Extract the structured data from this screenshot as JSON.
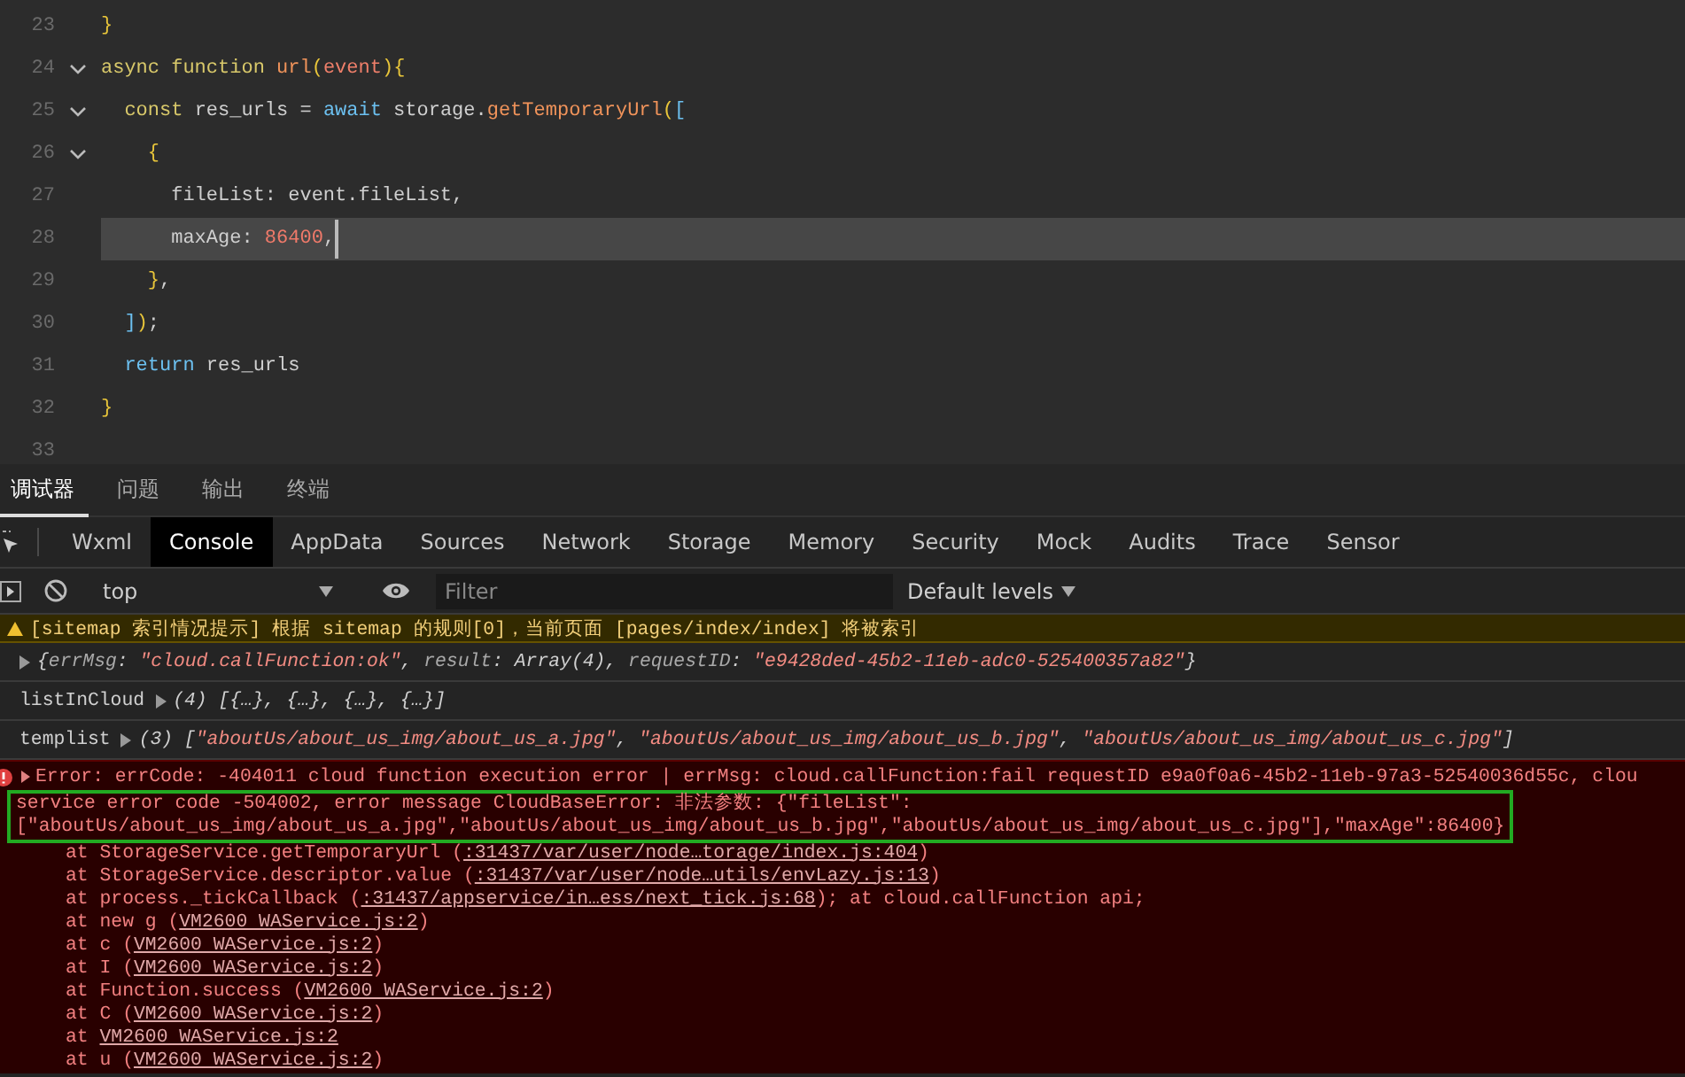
{
  "editor": {
    "lines": [
      {
        "number": "23",
        "fold": false,
        "current": false,
        "tokens": [
          {
            "text": "}",
            "kind": "brace"
          }
        ]
      },
      {
        "number": "24",
        "fold": true,
        "current": false,
        "tokens": [
          {
            "text": "async function ",
            "kind": "kw"
          },
          {
            "text": "url",
            "kind": "fn"
          },
          {
            "text": "(",
            "kind": "brace"
          },
          {
            "text": "event",
            "kind": "param"
          },
          {
            "text": "){",
            "kind": "brace"
          }
        ]
      },
      {
        "number": "25",
        "fold": true,
        "current": false,
        "tokens": [
          {
            "text": "  const ",
            "kind": "kw"
          },
          {
            "text": "res_urls = ",
            "kind": "plain"
          },
          {
            "text": "await ",
            "kind": "blue"
          },
          {
            "text": "storage.",
            "kind": "plain"
          },
          {
            "text": "getTemporaryUrl",
            "kind": "fn"
          },
          {
            "text": "(",
            "kind": "brace"
          },
          {
            "text": "[",
            "kind": "blue"
          }
        ]
      },
      {
        "number": "26",
        "fold": true,
        "current": false,
        "tokens": [
          {
            "text": "    {",
            "kind": "brace"
          }
        ]
      },
      {
        "number": "27",
        "fold": false,
        "current": false,
        "tokens": [
          {
            "text": "      fileList: event.fileList,",
            "kind": "plain"
          }
        ]
      },
      {
        "number": "28",
        "fold": false,
        "current": true,
        "tokens": [
          {
            "text": "      maxAge: ",
            "kind": "plain"
          },
          {
            "text": "86400",
            "kind": "num"
          },
          {
            "text": ",",
            "kind": "plain"
          }
        ]
      },
      {
        "number": "29",
        "fold": false,
        "current": false,
        "tokens": [
          {
            "text": "    }",
            "kind": "brace"
          },
          {
            "text": ",",
            "kind": "plain"
          }
        ]
      },
      {
        "number": "30",
        "fold": false,
        "current": false,
        "tokens": [
          {
            "text": "  ]",
            "kind": "blue"
          },
          {
            "text": ")",
            "kind": "brace"
          },
          {
            "text": ";",
            "kind": "plain"
          }
        ]
      },
      {
        "number": "31",
        "fold": false,
        "current": false,
        "tokens": [
          {
            "text": "  return ",
            "kind": "blue"
          },
          {
            "text": "res_urls",
            "kind": "plain"
          }
        ]
      },
      {
        "number": "32",
        "fold": false,
        "current": false,
        "tokens": [
          {
            "text": "}",
            "kind": "brace"
          }
        ]
      },
      {
        "number": "33",
        "fold": false,
        "current": false
      }
    ]
  },
  "panel_tabs": [
    {
      "label": "调试器",
      "selected": true
    },
    {
      "label": "问题",
      "selected": false
    },
    {
      "label": "输出",
      "selected": false
    },
    {
      "label": "终端",
      "selected": false
    }
  ],
  "devtools_tabs": [
    {
      "label": "Wxml",
      "selected": false
    },
    {
      "label": "Console",
      "selected": true
    },
    {
      "label": "AppData",
      "selected": false
    },
    {
      "label": "Sources",
      "selected": false
    },
    {
      "label": "Network",
      "selected": false
    },
    {
      "label": "Storage",
      "selected": false
    },
    {
      "label": "Memory",
      "selected": false
    },
    {
      "label": "Security",
      "selected": false
    },
    {
      "label": "Mock",
      "selected": false
    },
    {
      "label": "Audits",
      "selected": false
    },
    {
      "label": "Trace",
      "selected": false
    },
    {
      "label": "Sensor",
      "selected": false
    }
  ],
  "toolbar": {
    "context": "top",
    "filter_placeholder": "Filter",
    "levels": "Default levels"
  },
  "console": {
    "messages": [
      {
        "kind": "warning",
        "text": "[sitemap 索引情况提示] 根据 sitemap 的规则[0]，当前页面 [pages/index/index] 将被索引"
      },
      {
        "kind": "object",
        "tokens": [
          {
            "text": "{",
            "kind": "punc"
          },
          {
            "text": "errMsg",
            "kind": "key"
          },
          {
            "text": ": ",
            "kind": "punc"
          },
          {
            "text": "\"cloud.callFunction:ok\"",
            "kind": "str"
          },
          {
            "text": ", ",
            "kind": "punc"
          },
          {
            "text": "result",
            "kind": "key"
          },
          {
            "text": ": ",
            "kind": "punc"
          },
          {
            "text": "Array(4)",
            "kind": "val"
          },
          {
            "text": ", ",
            "kind": "punc"
          },
          {
            "text": "requestID",
            "kind": "key"
          },
          {
            "text": ": ",
            "kind": "punc"
          },
          {
            "text": "\"e9428ded-45b2-11eb-adc0-525400357a82\"",
            "kind": "str"
          },
          {
            "text": "}",
            "kind": "punc"
          }
        ]
      },
      {
        "kind": "labelled",
        "label": "listInCloud",
        "tokens": [
          {
            "text": "(4) [{…}, {…}, {…}, {…}]",
            "kind": "val"
          }
        ]
      },
      {
        "kind": "labelled",
        "label": "templist",
        "tokens": [
          {
            "text": "(3) [",
            "kind": "val"
          },
          {
            "text": "\"aboutUs/about_us_img/about_us_a.jpg\"",
            "kind": "str"
          },
          {
            "text": ", ",
            "kind": "punc"
          },
          {
            "text": "\"aboutUs/about_us_img/about_us_b.jpg\"",
            "kind": "str"
          },
          {
            "text": ", ",
            "kind": "punc"
          },
          {
            "text": "\"aboutUs/about_us_img/about_us_c.jpg\"",
            "kind": "str"
          },
          {
            "text": "]",
            "kind": "val"
          }
        ]
      }
    ],
    "error": {
      "head": "Error: errCode: -404011 cloud function execution error | errMsg: cloud.callFunction:fail requestID e9a0f0a6-45b2-11eb-97a3-52540036d55c, clou",
      "detail": [
        "service error code -504002, error message CloudBaseError: 非法参数: {\"fileList\":",
        "[\"aboutUs/about_us_img/about_us_a.jpg\",\"aboutUs/about_us_img/about_us_b.jpg\",\"aboutUs/about_us_img/about_us_c.jpg\"],\"maxAge\":86400}"
      ],
      "stack": [
        {
          "prefix": "at StorageService.getTemporaryUrl (",
          "link": ":31437/var/user/node…torage/index.js:404",
          "suffix": ")"
        },
        {
          "prefix": "at StorageService.descriptor.value (",
          "link": ":31437/var/user/node…utils/envLazy.js:13",
          "suffix": ")"
        },
        {
          "prefix": "at process._tickCallback (",
          "link": ":31437/appservice/in…ess/next_tick.js:68",
          "suffix": "); at cloud.callFunction api;"
        },
        {
          "prefix": "at new g (",
          "link": "VM2600 WAService.js:2",
          "suffix": ")"
        },
        {
          "prefix": "at c (",
          "link": "VM2600 WAService.js:2",
          "suffix": ")"
        },
        {
          "prefix": "at I (",
          "link": "VM2600 WAService.js:2",
          "suffix": ")"
        },
        {
          "prefix": "at Function.success (",
          "link": "VM2600 WAService.js:2",
          "suffix": ")"
        },
        {
          "prefix": "at C (",
          "link": "VM2600 WAService.js:2",
          "suffix": ")"
        },
        {
          "prefix": "at ",
          "link": "VM2600 WAService.js:2"
        },
        {
          "prefix": "at u (",
          "link": "VM2600 WAService.js:2",
          "suffix": ")"
        }
      ]
    }
  }
}
